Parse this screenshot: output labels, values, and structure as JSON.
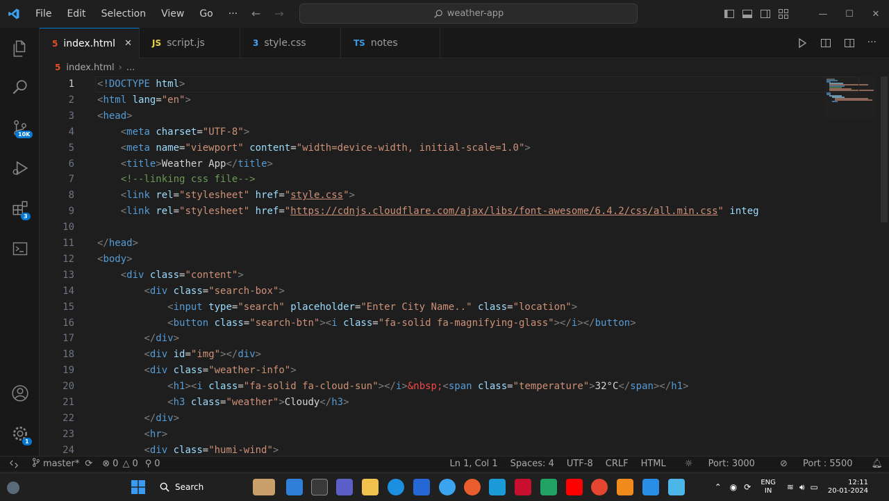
{
  "titlebar": {
    "menu": [
      "File",
      "Edit",
      "Selection",
      "View",
      "Go",
      "···"
    ],
    "search_text": "weather-app"
  },
  "activity_bar": {
    "source_control_badge": "10K",
    "extensions_badge": "3",
    "settings_badge": "1"
  },
  "tabs": [
    {
      "icon": "5",
      "label": "index.html",
      "close": "✕"
    },
    {
      "icon": "JS",
      "label": "script.js"
    },
    {
      "icon": "3",
      "label": "style.css"
    },
    {
      "icon": "TS",
      "label": "notes"
    }
  ],
  "breadcrumb": {
    "file": "index.html",
    "more": "..."
  },
  "editor": {
    "line_numbers": [
      "1",
      "2",
      "3",
      "4",
      "5",
      "6",
      "7",
      "8",
      "9",
      "10",
      "11",
      "12",
      "13",
      "14",
      "15",
      "16",
      "17",
      "18",
      "19",
      "20",
      "21",
      "22",
      "23",
      "24"
    ],
    "lines": [
      [
        {
          "t": "p",
          "v": "<!DOCTYPE html>"
        }
      ],
      [
        {
          "t": "p",
          "v": "<html lang=\"en\">"
        }
      ],
      [
        {
          "t": "p",
          "v": "<head>"
        }
      ],
      [
        {
          "t": "p",
          "v": "    <meta charset=\"UTF-8\">"
        }
      ],
      [
        {
          "t": "p",
          "v": "    <meta name=\"viewport\" content=\"width=device-width, initial-scale=1.0\">"
        }
      ],
      [
        {
          "t": "p",
          "v": "    <title>Weather App</title>"
        }
      ],
      [
        {
          "t": "p",
          "v": "    <!--linking css file-->"
        }
      ],
      [
        {
          "t": "p",
          "v": "    <link rel=\"stylesheet\" href=\"style.css\">"
        }
      ],
      [
        {
          "t": "p",
          "v": "    <link rel=\"stylesheet\" href=\"https://cdnjs.cloudflare.com/ajax/libs/font-awesome/6.4.2/css/all.min.css\" integ"
        }
      ],
      [
        {
          "t": "p",
          "v": ""
        }
      ],
      [
        {
          "t": "p",
          "v": "</head>"
        }
      ],
      [
        {
          "t": "p",
          "v": "<body>"
        }
      ],
      [
        {
          "t": "p",
          "v": "    <div class=\"content\">"
        }
      ],
      [
        {
          "t": "p",
          "v": "        <div class=\"search-box\">"
        }
      ],
      [
        {
          "t": "p",
          "v": "            <input type=\"search\" placeholder=\"Enter City Name..\" class=\"location\">"
        }
      ],
      [
        {
          "t": "p",
          "v": "            <button class=\"search-btn\"><i class=\"fa-solid fa-magnifying-glass\"></i></button>"
        }
      ],
      [
        {
          "t": "p",
          "v": "        </div>"
        }
      ],
      [
        {
          "t": "p",
          "v": "        <div id=\"img\"></div>"
        }
      ],
      [
        {
          "t": "p",
          "v": "        <div class=\"weather-info\">"
        }
      ],
      [
        {
          "t": "p",
          "v": "            <h1><i class=\"fa-solid fa-cloud-sun\"></i>&nbsp;<span class=\"temperature\">32°C</span></h1>"
        }
      ],
      [
        {
          "t": "p",
          "v": "            <h3 class=\"weather\">Cloudy</h3>"
        }
      ],
      [
        {
          "t": "p",
          "v": "        </div>"
        }
      ],
      [
        {
          "t": "p",
          "v": "        <hr>"
        }
      ],
      [
        {
          "t": "p",
          "v": "        <div class=\"humi-wind\">"
        }
      ]
    ]
  },
  "statusbar": {
    "branch": "master*",
    "errors": "0",
    "warnings": "0",
    "ports": "0",
    "position": "Ln 1, Col 1",
    "spaces": "Spaces: 4",
    "encoding": "UTF-8",
    "eol": "CRLF",
    "language": "HTML",
    "port1": "Port: 3000",
    "port2": "Port : 5500"
  },
  "taskbar": {
    "search_label": "Search",
    "lang_top": "ENG",
    "lang_bottom": "IN",
    "time": "12:11",
    "date": "20-01-2024"
  }
}
